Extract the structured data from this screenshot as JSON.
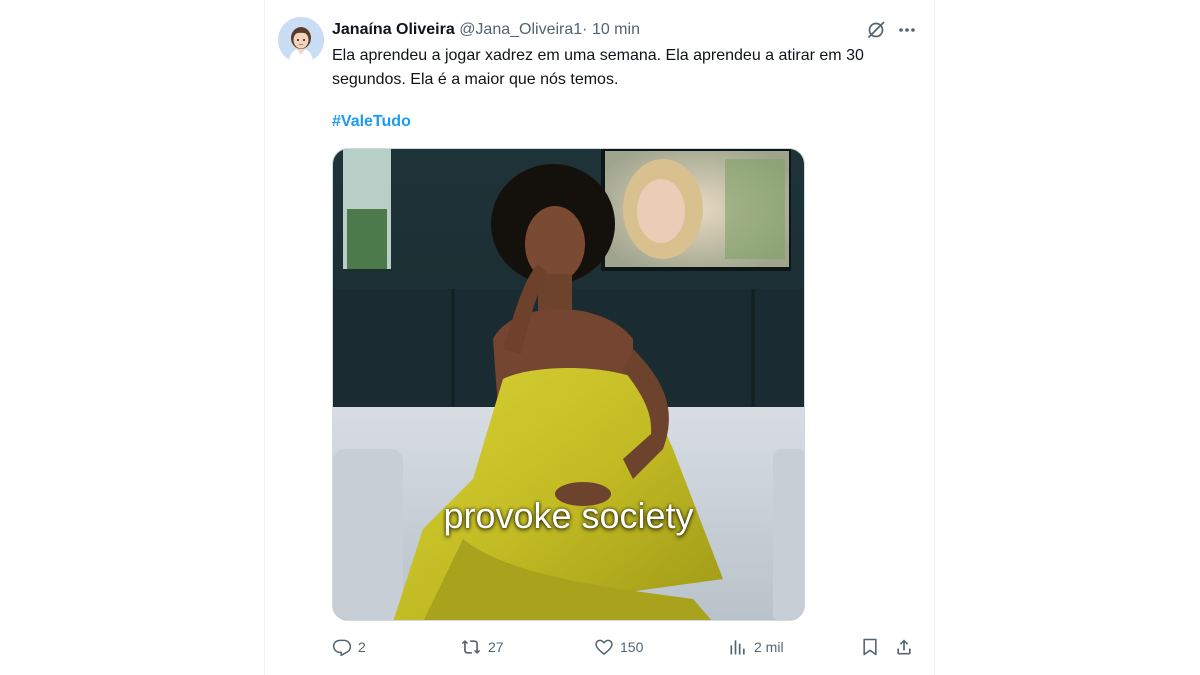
{
  "tweet": {
    "author_name": "Janaína Oliveira",
    "handle": "@Jana_Oliveira1",
    "separator": "·",
    "time": "10 min",
    "text": "Ela aprendeu a jogar xadrez em uma semana. Ela aprendeu a atirar em 30 segundos. Ela é a maior que nós temos.",
    "hashtag": "#ValeTudo",
    "media": {
      "caption": "provoke society"
    },
    "actions": {
      "replies": "2",
      "reposts": "27",
      "likes": "150",
      "views": "2 mil"
    }
  },
  "icons": {
    "header": [
      "grok-icon",
      "more-icon"
    ],
    "actions": [
      "reply-icon",
      "repost-icon",
      "like-icon",
      "views-icon",
      "bookmark-icon",
      "share-icon"
    ]
  },
  "colors": {
    "link": "#1d9bf0",
    "secondary_text": "#536471",
    "primary_text": "#0f1419",
    "dress": "#c9c32a"
  }
}
